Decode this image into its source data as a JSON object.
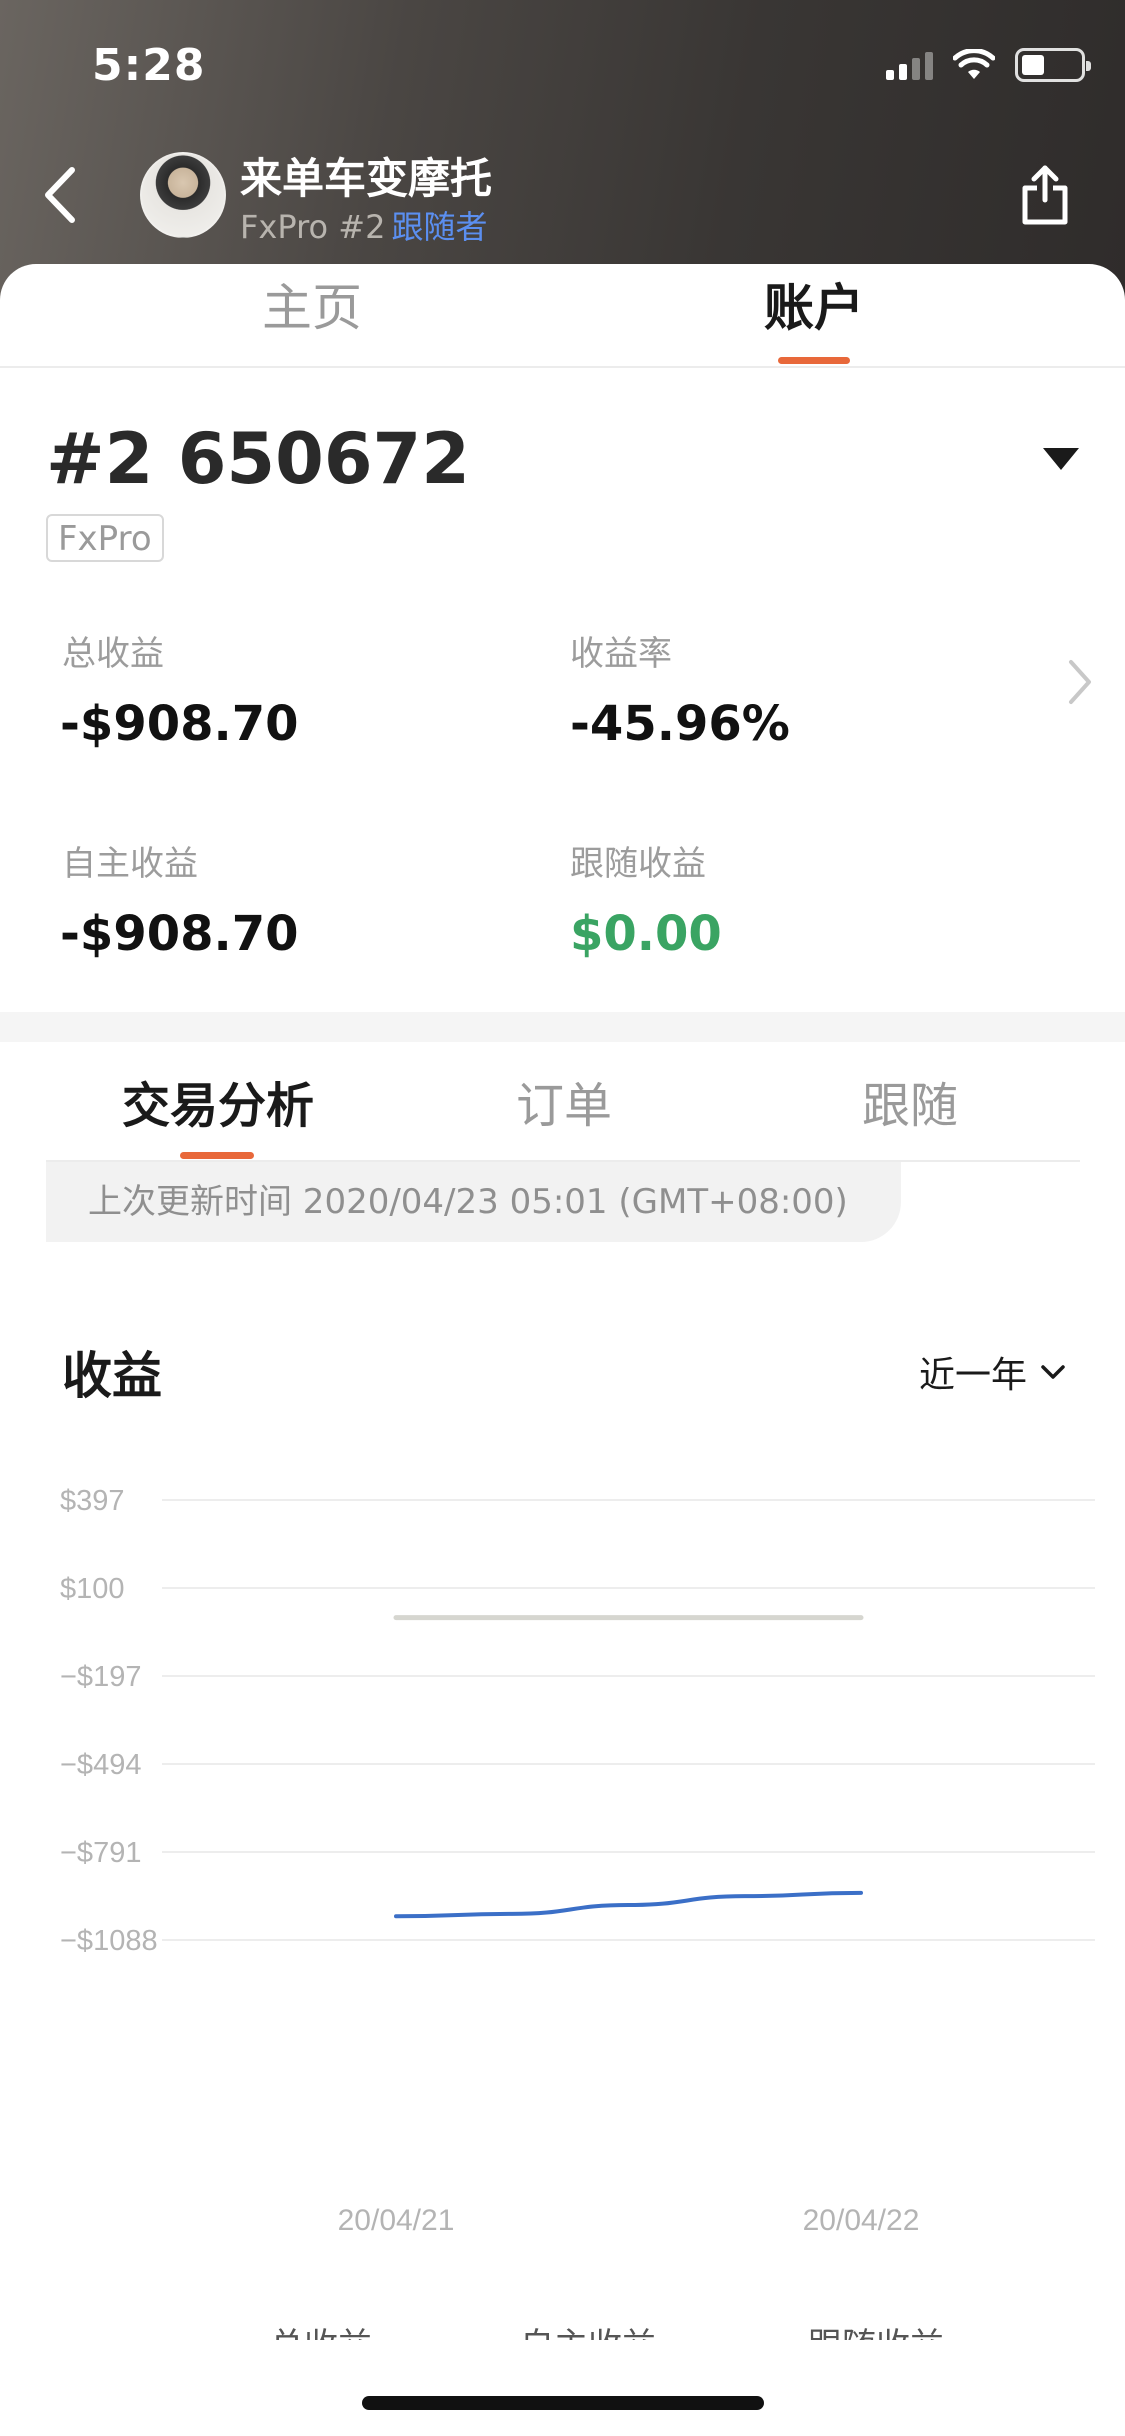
{
  "status_bar": {
    "time": "5:28"
  },
  "header": {
    "profile_name": "来单车变摩托",
    "broker": "FxPro",
    "account_no": "#2",
    "role": "跟随者"
  },
  "main_tabs": [
    {
      "label": "主页",
      "active": false
    },
    {
      "label": "账户",
      "active": true
    }
  ],
  "account": {
    "id": "#2 650672",
    "broker_tag": "FxPro"
  },
  "stats": {
    "total_profit_label": "总收益",
    "total_profit_value": "-$908.70",
    "return_rate_label": "收益率",
    "return_rate_value": "-45.96%",
    "self_profit_label": "自主收益",
    "self_profit_value": "-$908.70",
    "follow_profit_label": "跟随收益",
    "follow_profit_value": "$0.00"
  },
  "sub_tabs": [
    {
      "label": "交易分析",
      "active": true
    },
    {
      "label": "订单",
      "active": false
    },
    {
      "label": "跟随",
      "active": false
    }
  ],
  "last_update": "上次更新时间 2020/04/23 05:01 (GMT+08:00)",
  "profit_section": {
    "title": "收益",
    "range_label": "近一年"
  },
  "chart_data": {
    "type": "line",
    "y_ticks": [
      "$397",
      "$100",
      "−$197",
      "−$494",
      "−$791",
      "−$1088"
    ],
    "y_tick_values": [
      397,
      100,
      -197,
      -494,
      -791,
      -1088
    ],
    "ylim": [
      -1088,
      397
    ],
    "x_ticks": [
      "20/04/21",
      "20/04/22"
    ],
    "series": [
      {
        "values": [
          0,
          0
        ],
        "color": "#d6d6d0"
      },
      {
        "values": [
          -1008,
          -1000,
          -970,
          -940,
          -929
        ],
        "color": "#3b6fc7"
      }
    ],
    "grid": true
  },
  "legend": [
    "总收益",
    "自主收益",
    "跟随收益"
  ],
  "colors": {
    "accent": "#e8683a",
    "positive": "#3aa463",
    "link": "#5b8ff0",
    "line_blue": "#3b6fc7"
  }
}
